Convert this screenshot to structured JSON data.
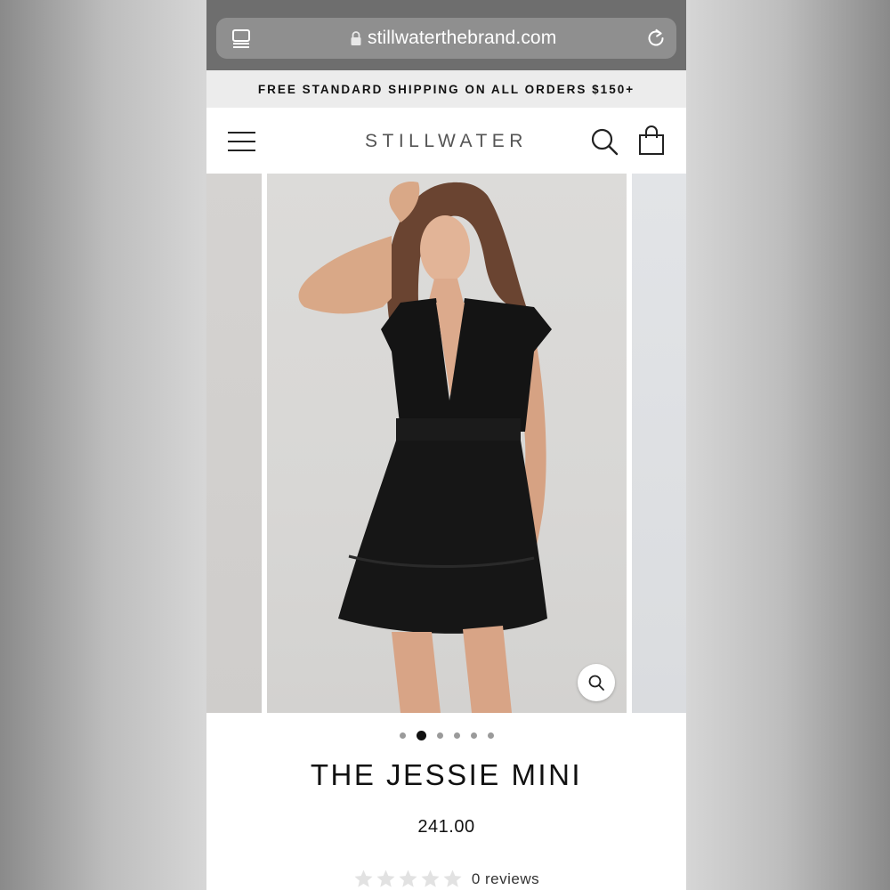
{
  "browser": {
    "url": "stillwaterthebrand.com"
  },
  "announcement": {
    "text": "FREE STANDARD SHIPPING ON ALL ORDERS $150+"
  },
  "header": {
    "brand": "STILLWATER"
  },
  "gallery": {
    "slide_count": 6,
    "active_slide": 2
  },
  "product": {
    "title": "THE JESSIE MINI",
    "price": "241.00",
    "rating": 0,
    "reviews_label": "0 reviews"
  },
  "colors": {
    "safari_bar": "#6e6e6e",
    "announcement_bg": "#ececec",
    "text_primary": "#111111",
    "brand_text": "#555555"
  }
}
